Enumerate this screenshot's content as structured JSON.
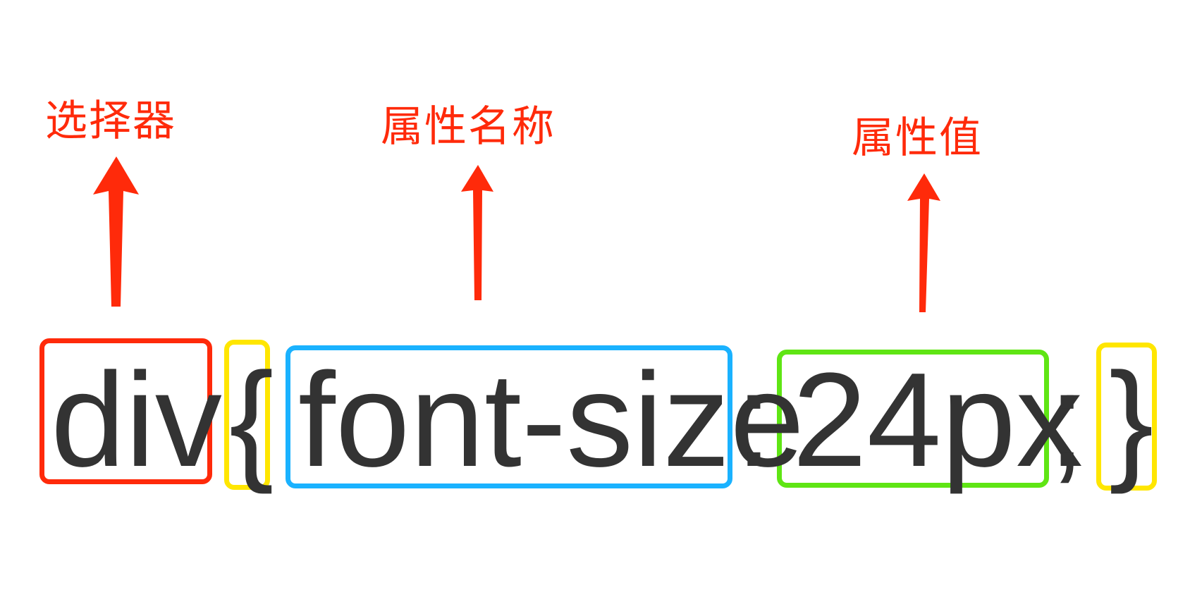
{
  "annotations": {
    "selector": "选择器",
    "property_name": "属性名称",
    "property_value": "属性值"
  },
  "code": {
    "selector": "div",
    "open_brace": "{",
    "property_name": "font-size",
    "colon": ":",
    "property_value": "24px",
    "semicolon": ";",
    "close_brace": "}"
  },
  "colors": {
    "annotation_red": "#ff2a0a",
    "selector_box": "#ff2a0a",
    "brace_box": "#ffe600",
    "property_name_box": "#1ab2ff",
    "property_value_box": "#5fe514",
    "code_text": "#333333"
  }
}
